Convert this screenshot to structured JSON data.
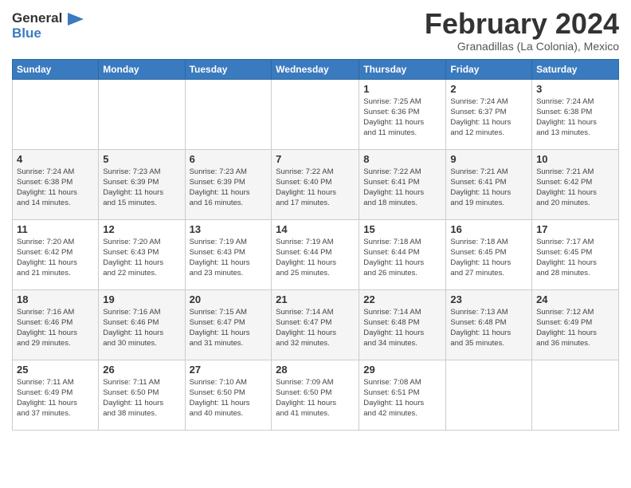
{
  "logo": {
    "line1": "General",
    "line2": "Blue"
  },
  "header": {
    "title": "February 2024",
    "subtitle": "Granadillas (La Colonia), Mexico"
  },
  "days_of_week": [
    "Sunday",
    "Monday",
    "Tuesday",
    "Wednesday",
    "Thursday",
    "Friday",
    "Saturday"
  ],
  "weeks": [
    [
      {
        "day": "",
        "info": ""
      },
      {
        "day": "",
        "info": ""
      },
      {
        "day": "",
        "info": ""
      },
      {
        "day": "",
        "info": ""
      },
      {
        "day": "1",
        "info": "Sunrise: 7:25 AM\nSunset: 6:36 PM\nDaylight: 11 hours\nand 11 minutes."
      },
      {
        "day": "2",
        "info": "Sunrise: 7:24 AM\nSunset: 6:37 PM\nDaylight: 11 hours\nand 12 minutes."
      },
      {
        "day": "3",
        "info": "Sunrise: 7:24 AM\nSunset: 6:38 PM\nDaylight: 11 hours\nand 13 minutes."
      }
    ],
    [
      {
        "day": "4",
        "info": "Sunrise: 7:24 AM\nSunset: 6:38 PM\nDaylight: 11 hours\nand 14 minutes."
      },
      {
        "day": "5",
        "info": "Sunrise: 7:23 AM\nSunset: 6:39 PM\nDaylight: 11 hours\nand 15 minutes."
      },
      {
        "day": "6",
        "info": "Sunrise: 7:23 AM\nSunset: 6:39 PM\nDaylight: 11 hours\nand 16 minutes."
      },
      {
        "day": "7",
        "info": "Sunrise: 7:22 AM\nSunset: 6:40 PM\nDaylight: 11 hours\nand 17 minutes."
      },
      {
        "day": "8",
        "info": "Sunrise: 7:22 AM\nSunset: 6:41 PM\nDaylight: 11 hours\nand 18 minutes."
      },
      {
        "day": "9",
        "info": "Sunrise: 7:21 AM\nSunset: 6:41 PM\nDaylight: 11 hours\nand 19 minutes."
      },
      {
        "day": "10",
        "info": "Sunrise: 7:21 AM\nSunset: 6:42 PM\nDaylight: 11 hours\nand 20 minutes."
      }
    ],
    [
      {
        "day": "11",
        "info": "Sunrise: 7:20 AM\nSunset: 6:42 PM\nDaylight: 11 hours\nand 21 minutes."
      },
      {
        "day": "12",
        "info": "Sunrise: 7:20 AM\nSunset: 6:43 PM\nDaylight: 11 hours\nand 22 minutes."
      },
      {
        "day": "13",
        "info": "Sunrise: 7:19 AM\nSunset: 6:43 PM\nDaylight: 11 hours\nand 23 minutes."
      },
      {
        "day": "14",
        "info": "Sunrise: 7:19 AM\nSunset: 6:44 PM\nDaylight: 11 hours\nand 25 minutes."
      },
      {
        "day": "15",
        "info": "Sunrise: 7:18 AM\nSunset: 6:44 PM\nDaylight: 11 hours\nand 26 minutes."
      },
      {
        "day": "16",
        "info": "Sunrise: 7:18 AM\nSunset: 6:45 PM\nDaylight: 11 hours\nand 27 minutes."
      },
      {
        "day": "17",
        "info": "Sunrise: 7:17 AM\nSunset: 6:45 PM\nDaylight: 11 hours\nand 28 minutes."
      }
    ],
    [
      {
        "day": "18",
        "info": "Sunrise: 7:16 AM\nSunset: 6:46 PM\nDaylight: 11 hours\nand 29 minutes."
      },
      {
        "day": "19",
        "info": "Sunrise: 7:16 AM\nSunset: 6:46 PM\nDaylight: 11 hours\nand 30 minutes."
      },
      {
        "day": "20",
        "info": "Sunrise: 7:15 AM\nSunset: 6:47 PM\nDaylight: 11 hours\nand 31 minutes."
      },
      {
        "day": "21",
        "info": "Sunrise: 7:14 AM\nSunset: 6:47 PM\nDaylight: 11 hours\nand 32 minutes."
      },
      {
        "day": "22",
        "info": "Sunrise: 7:14 AM\nSunset: 6:48 PM\nDaylight: 11 hours\nand 34 minutes."
      },
      {
        "day": "23",
        "info": "Sunrise: 7:13 AM\nSunset: 6:48 PM\nDaylight: 11 hours\nand 35 minutes."
      },
      {
        "day": "24",
        "info": "Sunrise: 7:12 AM\nSunset: 6:49 PM\nDaylight: 11 hours\nand 36 minutes."
      }
    ],
    [
      {
        "day": "25",
        "info": "Sunrise: 7:11 AM\nSunset: 6:49 PM\nDaylight: 11 hours\nand 37 minutes."
      },
      {
        "day": "26",
        "info": "Sunrise: 7:11 AM\nSunset: 6:50 PM\nDaylight: 11 hours\nand 38 minutes."
      },
      {
        "day": "27",
        "info": "Sunrise: 7:10 AM\nSunset: 6:50 PM\nDaylight: 11 hours\nand 40 minutes."
      },
      {
        "day": "28",
        "info": "Sunrise: 7:09 AM\nSunset: 6:50 PM\nDaylight: 11 hours\nand 41 minutes."
      },
      {
        "day": "29",
        "info": "Sunrise: 7:08 AM\nSunset: 6:51 PM\nDaylight: 11 hours\nand 42 minutes."
      },
      {
        "day": "",
        "info": ""
      },
      {
        "day": "",
        "info": ""
      }
    ]
  ],
  "colors": {
    "header_bg": "#3a7abf",
    "header_text": "#ffffff",
    "border": "#cccccc"
  }
}
